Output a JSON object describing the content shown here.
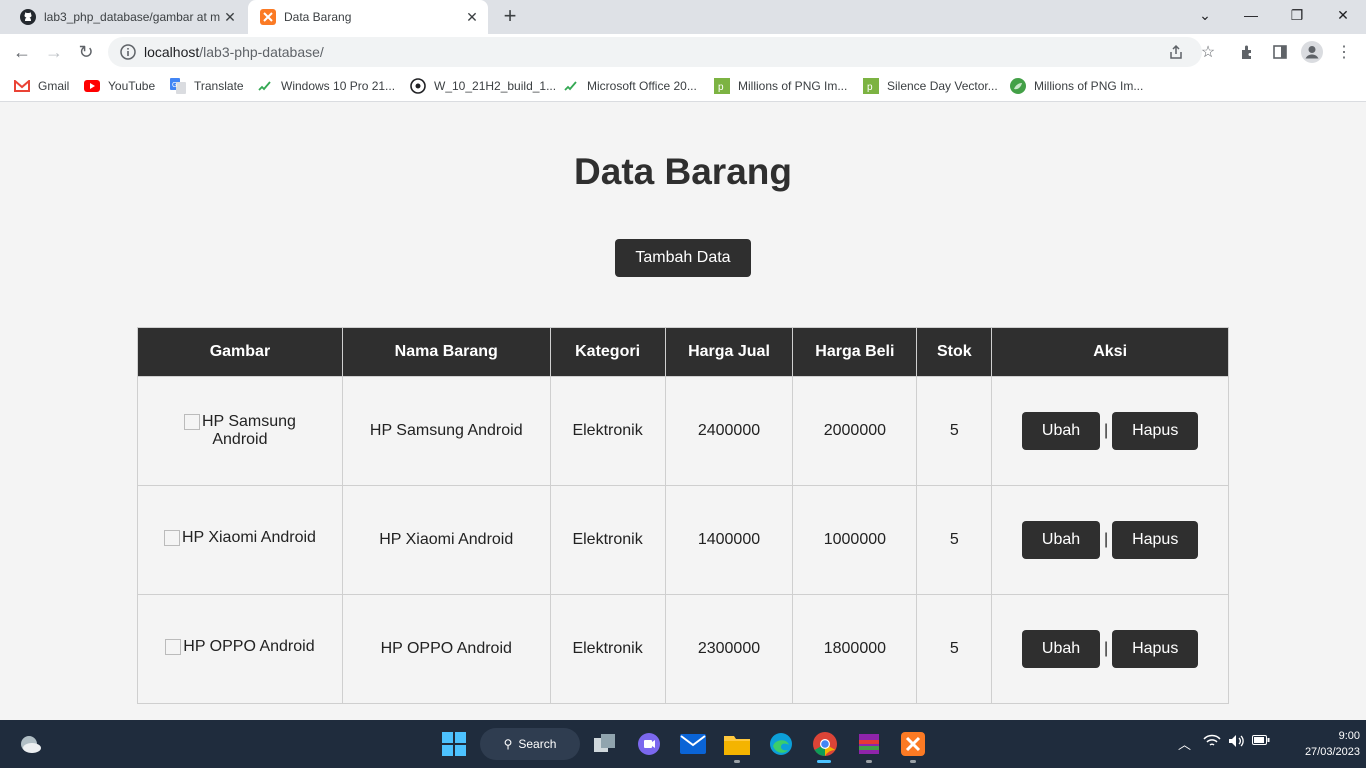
{
  "browser": {
    "tabs": [
      {
        "title": "lab3_php_database/gambar at m",
        "icon": "github-icon"
      },
      {
        "title": "Data Barang",
        "icon": "xampp-icon"
      }
    ],
    "url_host": "localhost",
    "url_path": "/lab3-php-database/",
    "bookmarks": [
      {
        "label": "Gmail",
        "icon": "gmail-icon"
      },
      {
        "label": "YouTube",
        "icon": "youtube-icon"
      },
      {
        "label": "Translate",
        "icon": "translate-icon"
      },
      {
        "label": "Windows 10 Pro 21...",
        "icon": "link-icon"
      },
      {
        "label": "W_10_21H2_build_1...",
        "icon": "chrome-icon"
      },
      {
        "label": "Microsoft Office 20...",
        "icon": "link-icon"
      },
      {
        "label": "Millions of PNG Im...",
        "icon": "png-icon"
      },
      {
        "label": "Silence Day Vector...",
        "icon": "png-icon"
      },
      {
        "label": "Millions of PNG Im...",
        "icon": "leaf-icon"
      }
    ]
  },
  "page": {
    "title": "Data Barang",
    "add_button": "Tambah Data",
    "table": {
      "headers": [
        "Gambar",
        "Nama Barang",
        "Kategori",
        "Harga Jual",
        "Harga Beli",
        "Stok",
        "Aksi"
      ],
      "rows": [
        {
          "gambar_alt": "HP Samsung Android",
          "nama": "HP Samsung Android",
          "kategori": "Elektronik",
          "harga_jual": "2400000",
          "harga_beli": "2000000",
          "stok": "5"
        },
        {
          "gambar_alt": "HP Xiaomi Android",
          "nama": "HP Xiaomi Android",
          "kategori": "Elektronik",
          "harga_jual": "1400000",
          "harga_beli": "1000000",
          "stok": "5"
        },
        {
          "gambar_alt": "HP OPPO Android",
          "nama": "HP OPPO Android",
          "kategori": "Elektronik",
          "harga_jual": "2300000",
          "harga_beli": "1800000",
          "stok": "5"
        }
      ],
      "edit_label": "Ubah",
      "delete_label": "Hapus",
      "separator": "|"
    }
  },
  "taskbar": {
    "search_label": "Search",
    "time": "9:00",
    "date": "27/03/2023"
  },
  "colors": {
    "dark": "#2f2f2f",
    "page_bg": "#f4f4f4",
    "taskbar": "#1f2c3d"
  }
}
